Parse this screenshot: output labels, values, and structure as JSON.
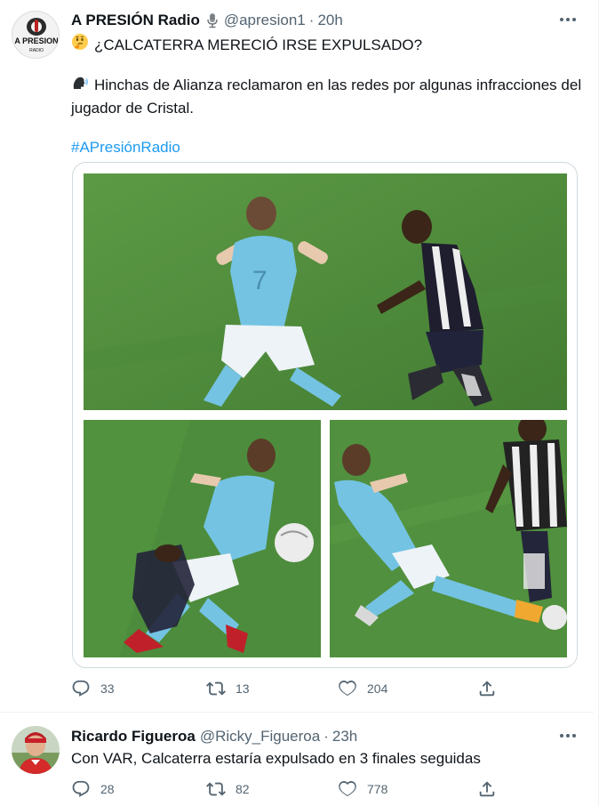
{
  "tweets": [
    {
      "author_name": "A PRESIÓN Radio",
      "handle": "@apresion1",
      "separator": "·",
      "time": "20h",
      "line1": "¿CALCATERRA MERECIÓ IRSE EXPULSADO?",
      "line2a": "Hinchas de Alianza reclamaron en las redes por algunas infracciones del",
      "line2b": "jugador de Cristal.",
      "hashtag": "#APresiónRadio",
      "avatar_text": "A PRESION",
      "avatar_sub": "RADIO",
      "replies": "33",
      "retweets": "13",
      "likes": "204",
      "icons": [
        "thinking-face-icon",
        "speaking-head-icon",
        "microphone-icon",
        "more-icon",
        "reply-icon",
        "retweet-icon",
        "like-icon",
        "share-icon"
      ]
    },
    {
      "author_name": "Ricardo Figueroa",
      "handle": "@Ricky_Figueroa",
      "separator": "·",
      "time": "23h",
      "text": "Con VAR, Calcaterra estaría expulsado en 3 finales seguidas",
      "replies": "28",
      "retweets": "82",
      "likes": "778"
    }
  ],
  "colors": {
    "text": "#0f1419",
    "secondary": "#536471",
    "link": "#1d9bf0",
    "border": "#cfd9de",
    "pitch": "#4e8f3c",
    "sky_kit": "#74c3e3"
  }
}
